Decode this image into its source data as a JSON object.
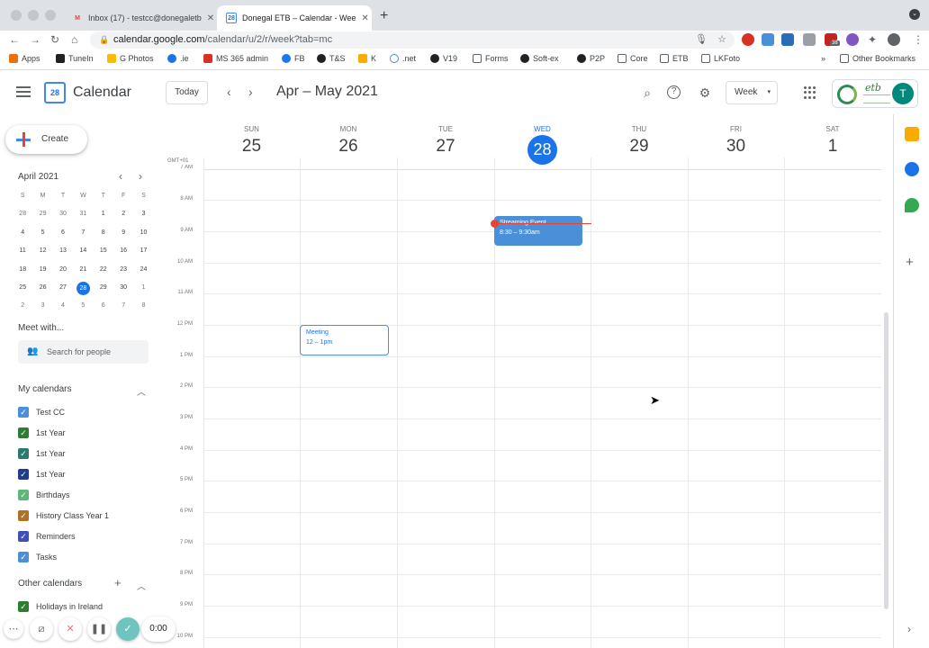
{
  "browser": {
    "tabs": [
      {
        "title": "Inbox (17) - testcc@donegaletb",
        "icon": "gmail-icon"
      },
      {
        "title": "Donegal ETB – Calendar - Wee",
        "icon": "calendar-icon"
      }
    ],
    "url_host": "calendar.google.com",
    "url_path": "/calendar/u/2/r/week?tab=mc",
    "extension_badge": "38",
    "bookmarks": [
      "Apps",
      "TuneIn",
      "G Photos",
      ".ie",
      "MS 365 admin",
      "FB",
      "T&S",
      "K",
      ".net",
      "V19",
      "Forms",
      "Soft-ex",
      "P2P",
      "Core",
      "ETB",
      "LKFoto"
    ],
    "bookmarks_more": "»",
    "other_bookmarks": "Other Bookmarks"
  },
  "header": {
    "app_name": "Calendar",
    "logo_day": "28",
    "today_label": "Today",
    "range_title": "Apr – May 2021",
    "view_label": "Week",
    "org_logo_text": "etb",
    "avatar_initial": "T"
  },
  "sidebar": {
    "create_label": "Create",
    "mini_month": "April 2021",
    "weekday_headers": [
      "S",
      "M",
      "T",
      "W",
      "T",
      "F",
      "S"
    ],
    "mini_weeks": [
      [
        "28",
        "29",
        "30",
        "31",
        "1",
        "2",
        "3"
      ],
      [
        "4",
        "5",
        "6",
        "7",
        "8",
        "9",
        "10"
      ],
      [
        "11",
        "12",
        "13",
        "14",
        "15",
        "16",
        "17"
      ],
      [
        "18",
        "19",
        "20",
        "21",
        "22",
        "23",
        "24"
      ],
      [
        "25",
        "26",
        "27",
        "28",
        "29",
        "30",
        "1"
      ],
      [
        "2",
        "3",
        "4",
        "5",
        "6",
        "7",
        "8"
      ]
    ],
    "meet_title": "Meet with...",
    "people_placeholder": "Search for people",
    "my_calendars_title": "My calendars",
    "my_calendars": [
      {
        "name": "Test CC",
        "color": "#4a8fd8"
      },
      {
        "name": "1st Year",
        "color": "#2e7d32"
      },
      {
        "name": "1st Year",
        "color": "#2b7a6f"
      },
      {
        "name": "1st Year",
        "color": "#1f3d8c"
      },
      {
        "name": "Birthdays",
        "color": "#5fb67a"
      },
      {
        "name": "History Class Year 1",
        "color": "#b07025"
      },
      {
        "name": "Reminders",
        "color": "#3f51b5"
      },
      {
        "name": "Tasks",
        "color": "#4a8fd8"
      }
    ],
    "other_calendars_title": "Other calendars",
    "other_calendars": [
      {
        "name": "Holidays in Ireland",
        "color": "#2e7d32"
      }
    ]
  },
  "week": {
    "timezone": "GMT+01",
    "days": [
      {
        "dow": "SUN",
        "num": "25",
        "today": false
      },
      {
        "dow": "MON",
        "num": "26",
        "today": false
      },
      {
        "dow": "TUE",
        "num": "27",
        "today": false
      },
      {
        "dow": "WED",
        "num": "28",
        "today": true
      },
      {
        "dow": "THU",
        "num": "29",
        "today": false
      },
      {
        "dow": "FRI",
        "num": "30",
        "today": false
      },
      {
        "dow": "SAT",
        "num": "1",
        "today": false
      }
    ],
    "hours": [
      "7 AM",
      "8 AM",
      "9 AM",
      "10 AM",
      "11 AM",
      "12 PM",
      "1 PM",
      "2 PM",
      "3 PM",
      "4 PM",
      "5 PM",
      "6 PM",
      "7 PM",
      "8 PM",
      "9 PM",
      "10 PM"
    ],
    "events": [
      {
        "title": "Streaming Event",
        "time": "8:30 – 9:30am"
      },
      {
        "title": "Meeting",
        "time": "12 – 1pm"
      }
    ]
  },
  "recorder": {
    "elapsed": "0:00"
  }
}
